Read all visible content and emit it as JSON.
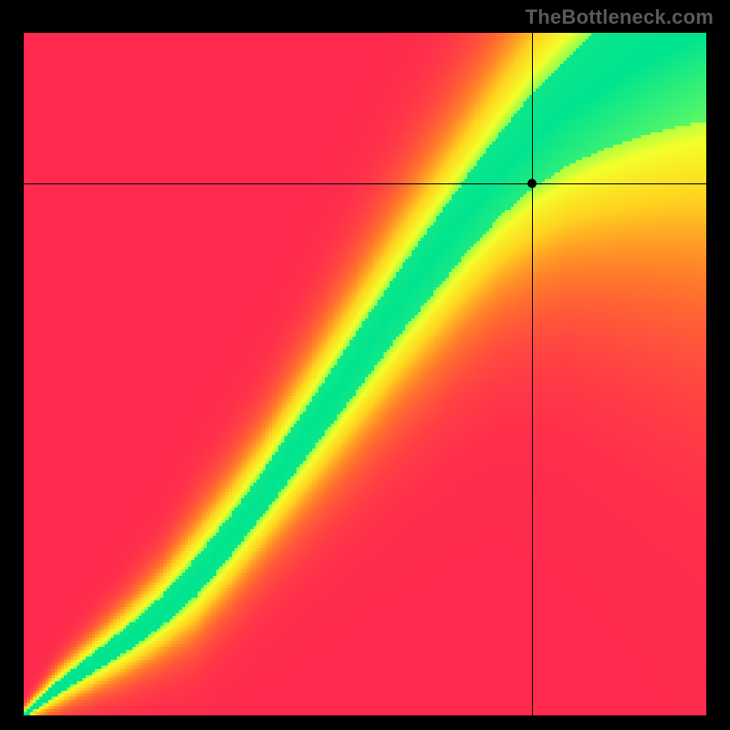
{
  "watermark": "TheBottleneck.com",
  "chart_data": {
    "type": "heatmap",
    "title": "",
    "xlabel": "",
    "ylabel": "",
    "xlim": [
      0,
      1
    ],
    "ylim": [
      0,
      1
    ],
    "grid": false,
    "crosshair": {
      "x": 0.745,
      "y": 0.78
    },
    "marker": {
      "x": 0.745,
      "y": 0.78
    },
    "ridge": [
      {
        "x": 0.0,
        "y": 0.0,
        "width": 0.004
      },
      {
        "x": 0.05,
        "y": 0.04,
        "width": 0.01
      },
      {
        "x": 0.1,
        "y": 0.075,
        "width": 0.014
      },
      {
        "x": 0.15,
        "y": 0.11,
        "width": 0.018
      },
      {
        "x": 0.2,
        "y": 0.15,
        "width": 0.022
      },
      {
        "x": 0.25,
        "y": 0.2,
        "width": 0.028
      },
      {
        "x": 0.3,
        "y": 0.26,
        "width": 0.03
      },
      {
        "x": 0.35,
        "y": 0.325,
        "width": 0.032
      },
      {
        "x": 0.4,
        "y": 0.395,
        "width": 0.036
      },
      {
        "x": 0.45,
        "y": 0.465,
        "width": 0.04
      },
      {
        "x": 0.5,
        "y": 0.535,
        "width": 0.044
      },
      {
        "x": 0.55,
        "y": 0.605,
        "width": 0.048
      },
      {
        "x": 0.6,
        "y": 0.67,
        "width": 0.052
      },
      {
        "x": 0.65,
        "y": 0.735,
        "width": 0.056
      },
      {
        "x": 0.7,
        "y": 0.795,
        "width": 0.062
      },
      {
        "x": 0.745,
        "y": 0.842,
        "width": 0.07
      },
      {
        "x": 0.8,
        "y": 0.888,
        "width": 0.08
      },
      {
        "x": 0.85,
        "y": 0.922,
        "width": 0.092
      },
      {
        "x": 0.9,
        "y": 0.952,
        "width": 0.104
      },
      {
        "x": 0.95,
        "y": 0.978,
        "width": 0.116
      },
      {
        "x": 1.0,
        "y": 1.0,
        "width": 0.128
      }
    ],
    "colorscale": [
      {
        "t": 0.0,
        "hex": "#ff2a4d"
      },
      {
        "t": 0.25,
        "hex": "#ff7a2a"
      },
      {
        "t": 0.5,
        "hex": "#ffd21f"
      },
      {
        "t": 0.75,
        "hex": "#f4ff2a"
      },
      {
        "t": 0.9,
        "hex": "#7dff55"
      },
      {
        "t": 1.0,
        "hex": "#00e48f"
      }
    ],
    "annotations": []
  }
}
